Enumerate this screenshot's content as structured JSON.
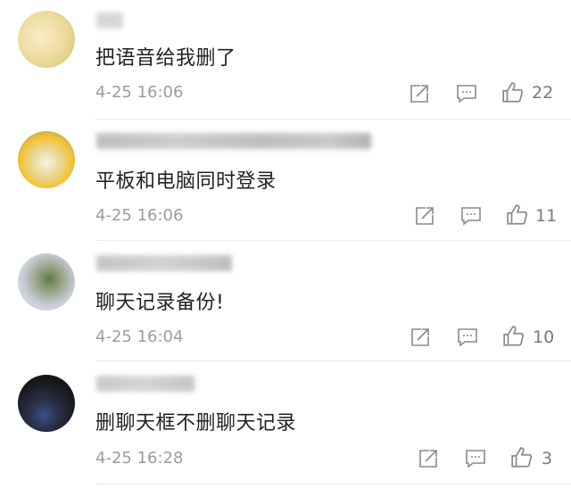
{
  "comments": [
    {
      "text": "把语音给我删了",
      "time": "4-25 16:06",
      "likes": "22",
      "avatar_colors": [
        "#f1e5b3",
        "#d8c27a"
      ]
    },
    {
      "text": "平板和电脑同时登录",
      "time": "4-25 16:06",
      "likes": "11",
      "avatar_colors": [
        "#f0d36a",
        "#8b7d6b"
      ]
    },
    {
      "text": "聊天记录备份!",
      "time": "4-25 16:04",
      "likes": "10",
      "avatar_colors": [
        "#d7dbe2",
        "#6d7f59"
      ]
    },
    {
      "text": "删聊天框不删聊天记录",
      "time": "4-25 16:28",
      "likes": "3",
      "avatar_colors": [
        "#1e1e28",
        "#3a4a7a"
      ]
    }
  ],
  "colors": {
    "text": "#222222",
    "meta": "#9c9c9c",
    "icon": "#8a8a8a"
  },
  "icons": {
    "share": "share-icon",
    "reply": "reply-icon",
    "like": "thumbs-up-icon"
  }
}
